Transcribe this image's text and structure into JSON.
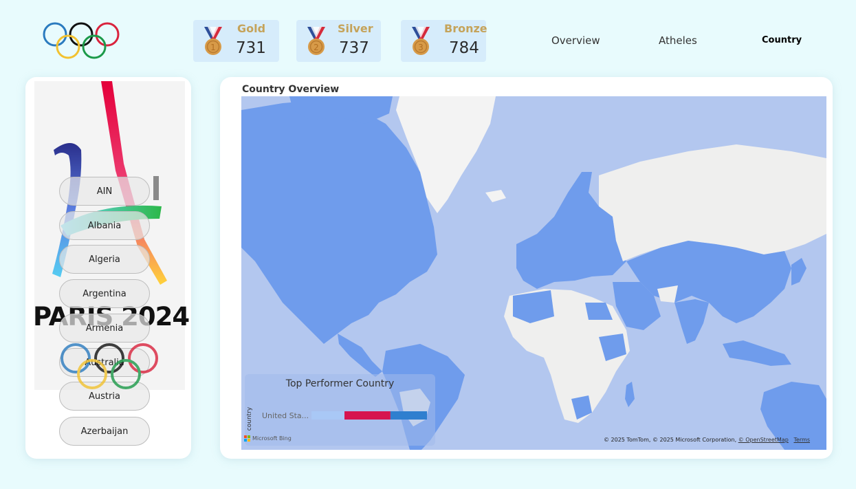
{
  "header": {
    "medals": [
      {
        "label": "Gold",
        "value": "731",
        "number": "1"
      },
      {
        "label": "Silver",
        "value": "737",
        "number": "2"
      },
      {
        "label": "Bronze",
        "value": "784",
        "number": "3"
      }
    ],
    "nav": [
      {
        "label": "Overview",
        "active": false
      },
      {
        "label": "Atheles",
        "active": false
      },
      {
        "label": "Country",
        "active": true
      }
    ]
  },
  "sidebar": {
    "logo_text": "PARIS 2024",
    "countries": [
      "AIN",
      "Albania",
      "Algeria",
      "Argentina",
      "Armenia",
      "Australia",
      "Austria",
      "Azerbaijan"
    ]
  },
  "map": {
    "title": "Country Overview",
    "overlay": {
      "title": "Top Performer Country",
      "axis_label": "country",
      "category": "United Sta...",
      "segments": [
        {
          "name": "bronze-share",
          "value": 0.28,
          "color": "#a9c8f6"
        },
        {
          "name": "gold-share",
          "value": 0.39,
          "color": "#d6144f"
        },
        {
          "name": "silver-share",
          "value": 0.31,
          "color": "#2f7fcf"
        }
      ]
    },
    "attribution": {
      "brand": "Microsoft Bing",
      "copyright": "© 2025 TomTom, © 2025 Microsoft Corporation,",
      "osm_link": "© OpenStreetMap",
      "terms_link": "Terms"
    }
  },
  "colors": {
    "background": "#e8fbfd",
    "medal_card": "#d6ecfb",
    "medal_label": "#c5a35a",
    "map_ocean": "#b3c7ef",
    "map_highlight": "#6f9cec",
    "map_land": "#efefee"
  }
}
